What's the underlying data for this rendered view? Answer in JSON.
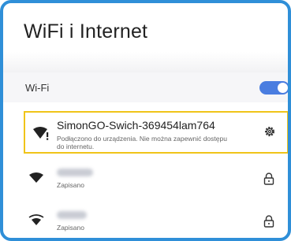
{
  "header": {
    "title": "WiFi i Internet"
  },
  "wifi_toggle": {
    "label": "Wi-Fi",
    "state": "on"
  },
  "connected_network": {
    "name": "SimonGO-Swich-369454lam764",
    "status": "Podłączono do urządzenia. Nie można zapewnić dostępu do internetu.",
    "highlight_color": "#f0c419",
    "icons": [
      "wifi-warning-icon",
      "gear-icon"
    ]
  },
  "networks": [
    {
      "status": "Zapisano",
      "icons": [
        "wifi-icon",
        "lock-icon"
      ]
    },
    {
      "status": "Zapisano",
      "icons": [
        "wifi-icon",
        "lock-icon"
      ]
    }
  ],
  "colors": {
    "frame": "#2f8fd8",
    "toggle": "#4a7de0"
  }
}
